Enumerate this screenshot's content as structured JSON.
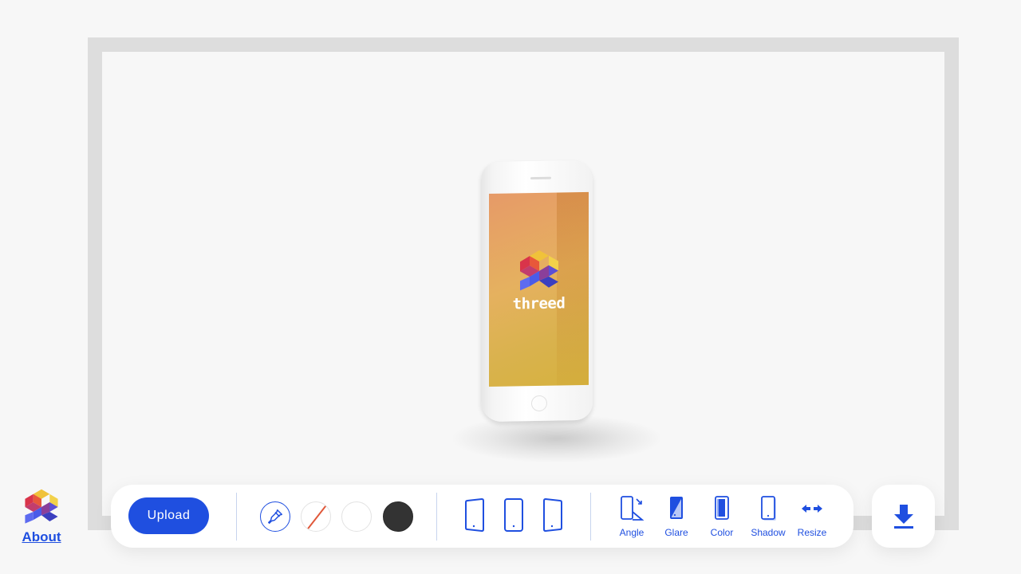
{
  "preview": {
    "screen_logo_text": "threed"
  },
  "about": {
    "label": "About"
  },
  "toolbar": {
    "upload_label": "Upload",
    "colors": {
      "accent": "#1f4fe0",
      "swatches": [
        "eyedropper",
        "none",
        "#ffffff",
        "#333333"
      ]
    },
    "device_icons": [
      "phone-tilted-left-icon",
      "phone-front-icon",
      "phone-tilted-right-icon"
    ],
    "tools": [
      {
        "label": "Angle",
        "icon": "angle-icon"
      },
      {
        "label": "Glare",
        "icon": "glare-icon"
      },
      {
        "label": "Color",
        "icon": "color-icon"
      },
      {
        "label": "Shadow",
        "icon": "shadow-icon"
      },
      {
        "label": "Resize",
        "icon": "resize-icon"
      }
    ]
  },
  "download": {
    "icon": "download-icon"
  }
}
